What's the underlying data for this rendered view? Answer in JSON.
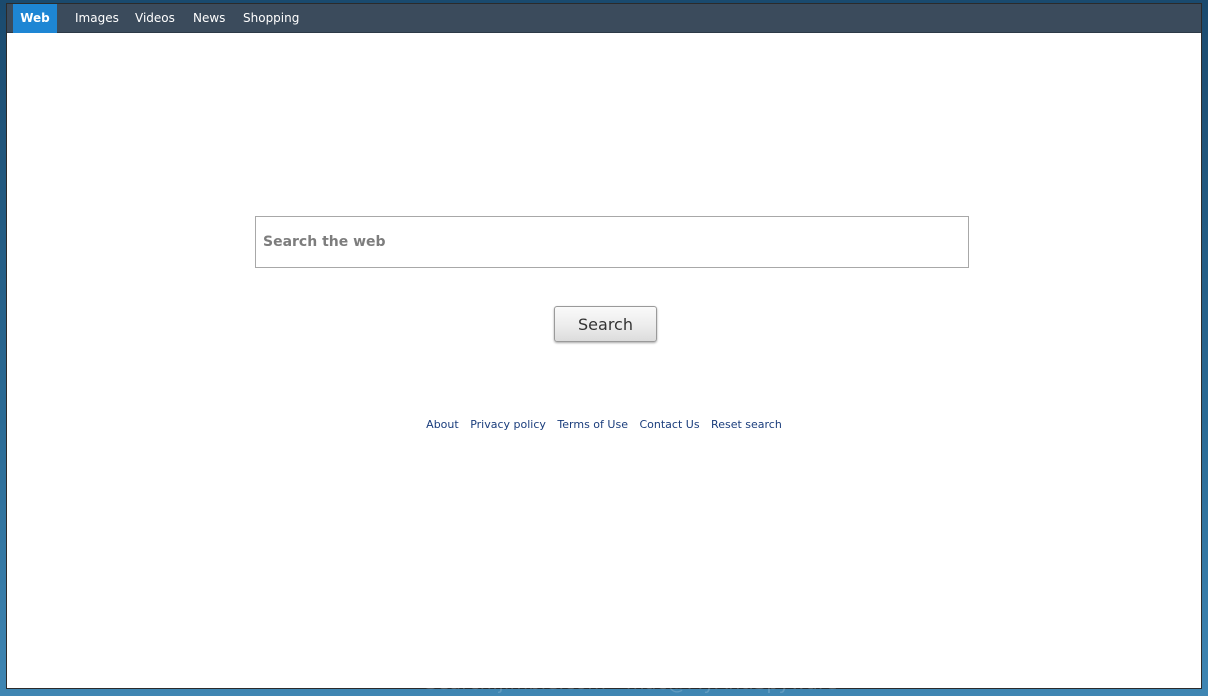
{
  "nav": {
    "items": [
      {
        "label": "Web",
        "active": true
      },
      {
        "label": "Images",
        "active": false
      },
      {
        "label": "Videos",
        "active": false
      },
      {
        "label": "News",
        "active": false
      },
      {
        "label": "Shopping",
        "active": false
      }
    ]
  },
  "search": {
    "placeholder": "Search the web",
    "button_label": "Search"
  },
  "footer": {
    "links": [
      "About",
      "Privacy policy",
      "Terms of Use",
      "Contact Us",
      "Reset search"
    ]
  },
  "watermark": "Search.jimbie.com - mac@MyAntiSpyware",
  "colors": {
    "nav_bg": "#3b4b5c",
    "nav_active": "#1e86d4",
    "link": "#1a3d7c"
  }
}
